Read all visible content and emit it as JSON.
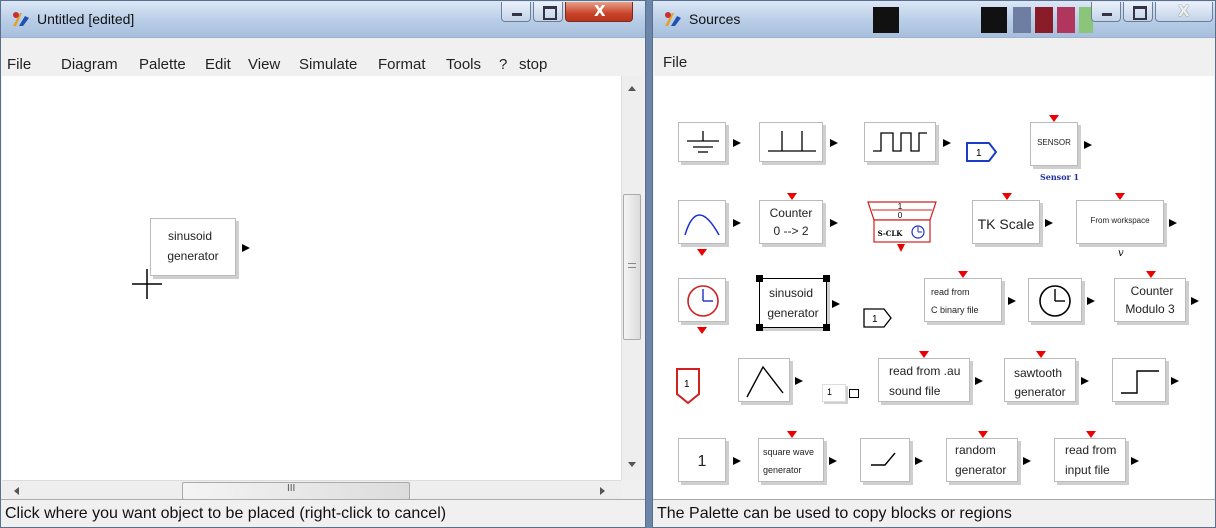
{
  "left_window": {
    "title": "Untitled [edited]",
    "menu": [
      "File",
      "Diagram",
      "Palette",
      "Edit",
      "View",
      "Simulate",
      "Format",
      "Tools",
      "?",
      "stop"
    ],
    "block": {
      "line1": "sinusoid",
      "line2": "generator"
    },
    "hscroll_label": "III",
    "status": "Click where you want object to be placed (right-click to cancel)"
  },
  "right_window": {
    "title": "Sources",
    "menu": [
      "File"
    ],
    "status": "The Palette can be used to copy blocks or regions",
    "blocks": {
      "bigsom_output": "1",
      "sensor": "SENSOR",
      "sensor_caption": "Sensor 1",
      "counter": [
        "Counter",
        "0 --> 2"
      ],
      "sampleclk": [
        "1",
        "0",
        "S-CLK"
      ],
      "tkscale": "TK Scale",
      "fromws": "From workspace",
      "fromws_caption": "v",
      "sinusoid": [
        "sinusoid",
        "generator"
      ],
      "readc": [
        "read from",
        "C binary file"
      ],
      "counter_mod": [
        "Counter",
        "Modulo 3"
      ],
      "inport": "1",
      "readau": [
        "read from .au",
        "sound file"
      ],
      "sawtooth": [
        "sawtooth",
        "generator"
      ],
      "const": "1",
      "gen_sqr": [
        "square wave",
        "generator"
      ],
      "random": [
        "random",
        "generator"
      ],
      "readinput": [
        "read from",
        "input file"
      ],
      "pulse_small": "1",
      "event_inport": "1",
      "output_port": "1"
    }
  },
  "icons": [
    "scilab-app-icon",
    "minimize-icon",
    "maximize-icon",
    "close-icon",
    "ground-icon",
    "step-icon",
    "pulse-icon",
    "ramp-icon",
    "clock-icon",
    "time-icon"
  ]
}
